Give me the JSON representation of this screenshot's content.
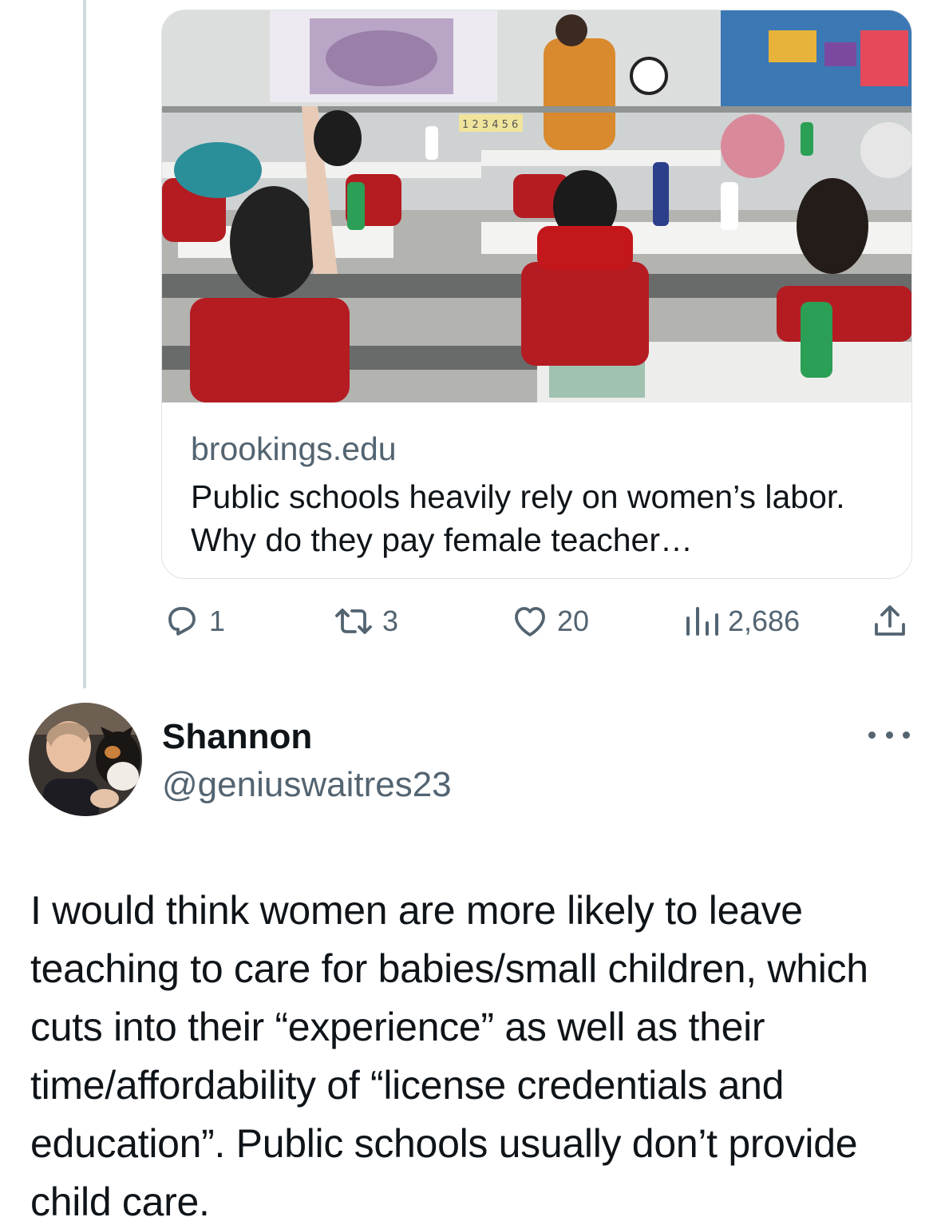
{
  "card": {
    "domain": "brookings.edu",
    "title": "Public schools heavily rely on women’s labor. Why do they pay female teacher…",
    "image_alt": "Classroom with students raising hands and a teacher at the front",
    "image_text": "1 2 3 4 5 6"
  },
  "actions": {
    "reply_count": "1",
    "retweet_count": "3",
    "like_count": "20",
    "views_count": "2,686"
  },
  "reply": {
    "display_name": "Shannon",
    "handle": "@geniuswaitres23",
    "text": "I would think women are more likely to leave teaching  to care for babies/small children, which cuts into their “experience” as well as their time/affordability of “license credentials and education”. Public schools usually don’t provide child care."
  },
  "colors": {
    "secondary_text": "#536471",
    "border": "#dfe4e8",
    "thread_line": "#cfd9de"
  },
  "icons": [
    "reply-icon",
    "retweet-icon",
    "like-icon",
    "views-icon",
    "share-icon",
    "more-icon"
  ]
}
